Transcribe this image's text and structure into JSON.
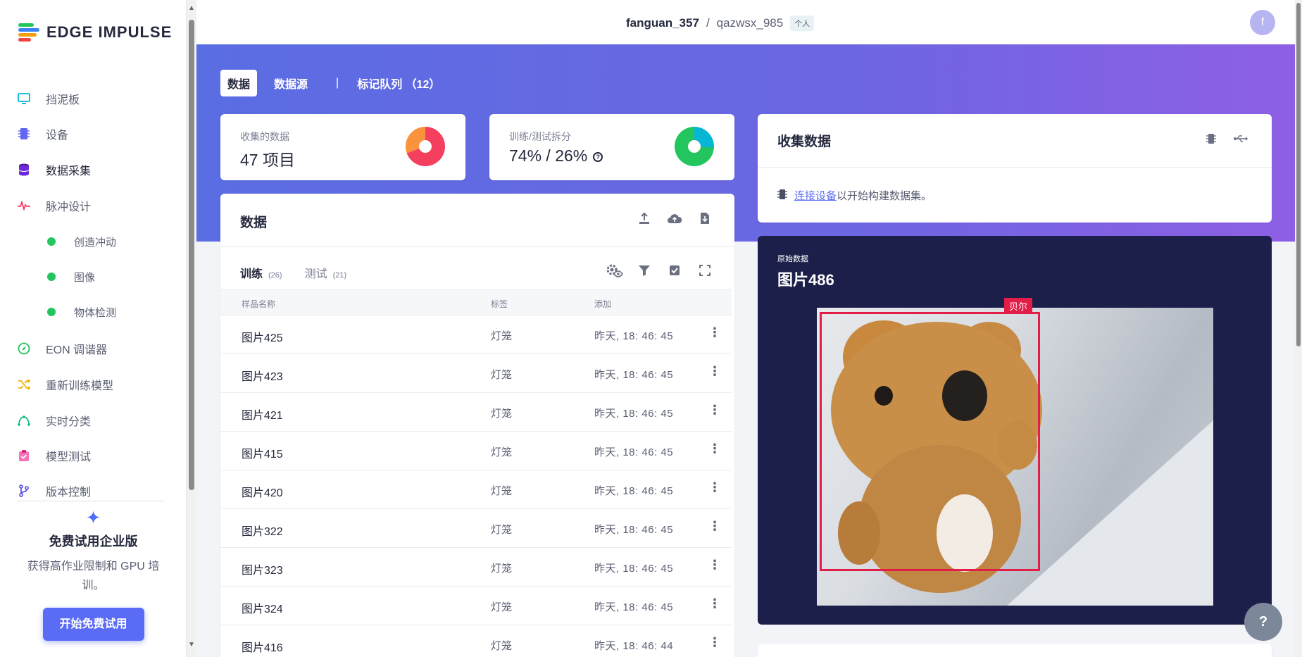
{
  "sidebar": {
    "logo_text": "EDGE IMPULSE",
    "items": [
      {
        "label": "挡泥板",
        "icon": "monitor-icon"
      },
      {
        "label": "设备",
        "icon": "chip-icon"
      },
      {
        "label": "数据采集",
        "icon": "database-icon"
      },
      {
        "label": "脉冲设计",
        "icon": "pulse-icon"
      },
      {
        "label": "创造冲动",
        "icon": "dot-icon"
      },
      {
        "label": "图像",
        "icon": "dot-icon"
      },
      {
        "label": "物体检测",
        "icon": "dot-icon"
      },
      {
        "label": "EON 调谐器",
        "icon": "compass-icon"
      },
      {
        "label": "重新训练模型",
        "icon": "shuffle-icon"
      },
      {
        "label": "实时分类",
        "icon": "live-icon"
      },
      {
        "label": "模型测试",
        "icon": "clipboard-check-icon"
      },
      {
        "label": "版本控制",
        "icon": "branch-icon"
      }
    ],
    "trial": {
      "title": "免费试用企业版",
      "desc": "获得高作业限制和 GPU 培训。",
      "button": "开始免费试用"
    }
  },
  "topbar": {
    "user": "fanguan_357",
    "sep": "/",
    "project": "qazwsx_985",
    "badge": "个人",
    "avatar": "f"
  },
  "tabs": [
    {
      "label": "数据"
    },
    {
      "label": "数据源"
    },
    {
      "label": "标记队列 （12）"
    }
  ],
  "tab_separator": "|",
  "stats": {
    "collected": {
      "label": "收集的数据",
      "value": "47 项目"
    },
    "split": {
      "label": "训练/测试拆分",
      "value": "74% / 26%",
      "train_pct": 74,
      "test_pct": 26
    }
  },
  "data_panel": {
    "title": "数据",
    "subtabs": [
      {
        "label": "训练",
        "count": "(26)"
      },
      {
        "label": "测试",
        "count": "(21)"
      }
    ],
    "columns": [
      "样品名称",
      "标签",
      "添加"
    ],
    "rows": [
      {
        "name": "图片425",
        "label": "灯笼",
        "added": "昨天, 18: 46: 45"
      },
      {
        "name": "图片423",
        "label": "灯笼",
        "added": "昨天, 18: 46: 45"
      },
      {
        "name": "图片421",
        "label": "灯笼",
        "added": "昨天, 18: 46: 45"
      },
      {
        "name": "图片415",
        "label": "灯笼",
        "added": "昨天, 18: 46: 45"
      },
      {
        "name": "图片420",
        "label": "灯笼",
        "added": "昨天, 18: 46: 45"
      },
      {
        "name": "图片322",
        "label": "灯笼",
        "added": "昨天, 18: 46: 45"
      },
      {
        "name": "图片323",
        "label": "灯笼",
        "added": "昨天, 18: 46: 45"
      },
      {
        "name": "图片324",
        "label": "灯笼",
        "added": "昨天, 18: 46: 45"
      },
      {
        "name": "图片416",
        "label": "灯笼",
        "added": "昨天, 18: 46: 44"
      }
    ]
  },
  "collect_panel": {
    "title": "收集数据",
    "link": "连接设备",
    "text": "以开始构建数据集。"
  },
  "raw_panel": {
    "subtitle": "原始数据",
    "title": "图片486",
    "bbox_label": "贝尔"
  },
  "help": "?",
  "colors": {
    "accent": "#5a6cf5",
    "bbox": "#e11d48",
    "collected_donut_a": "#f43f5e",
    "collected_donut_b": "#fb923c",
    "split_train": "#22c55e",
    "split_test": "#06b6d4"
  }
}
